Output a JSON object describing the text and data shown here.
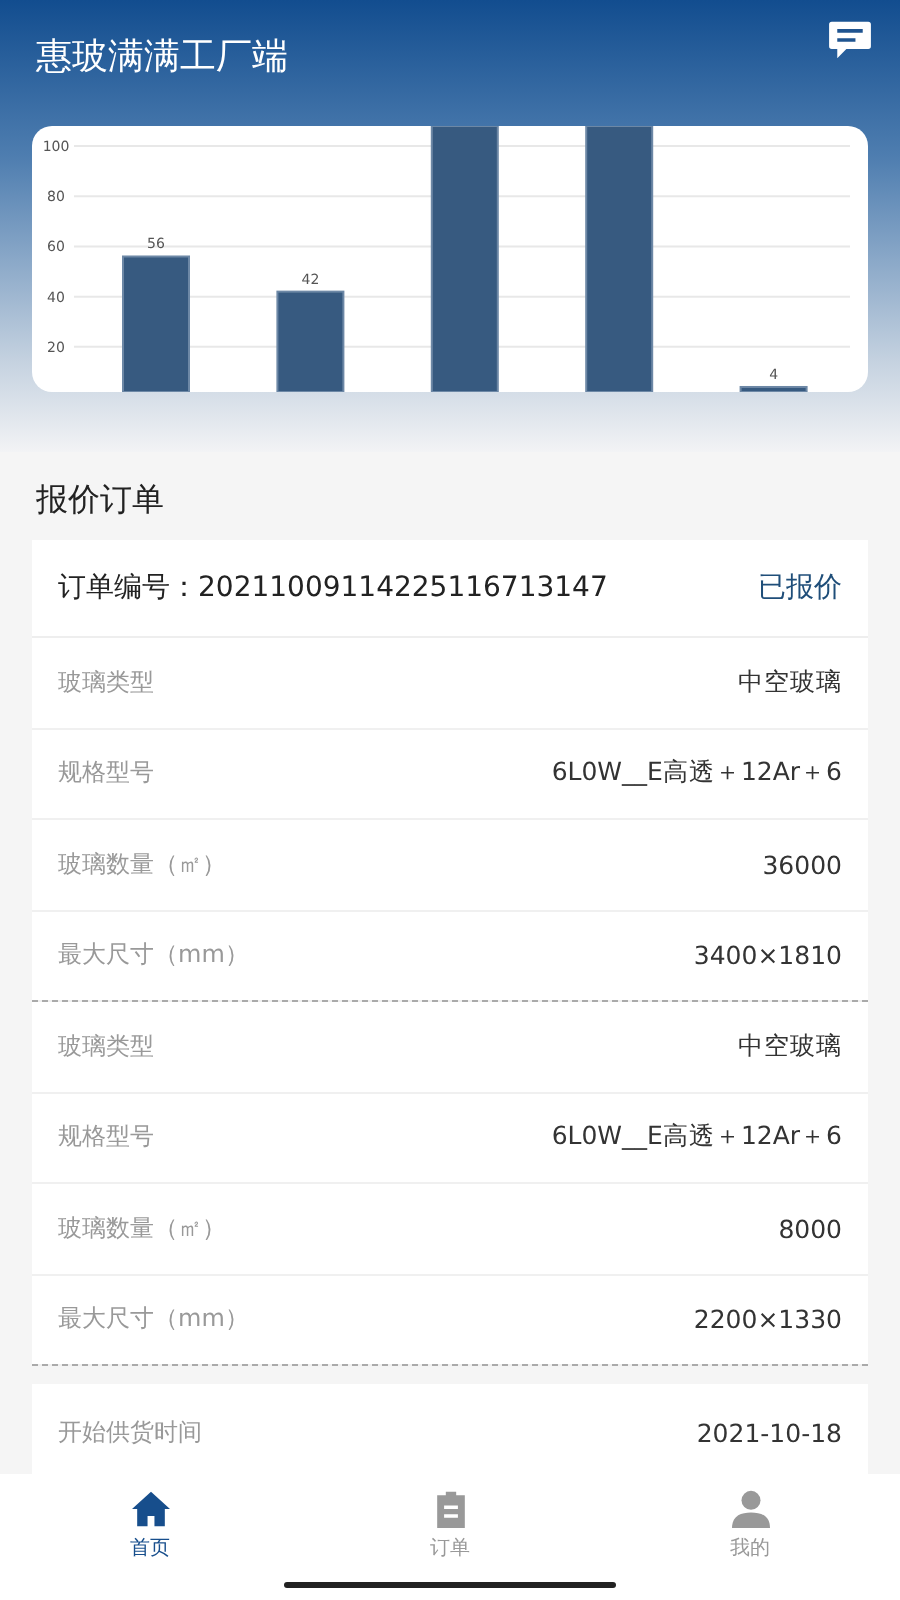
{
  "header": {
    "title": "惠玻满满工厂端"
  },
  "chart": {
    "chart_data": {
      "type": "bar",
      "ylim": [
        2,
        108
      ],
      "yticks": [
        20,
        40,
        60,
        80,
        100
      ],
      "grid": true,
      "value_labels": [
        "56",
        "42",
        null,
        null,
        "4"
      ],
      "series": [
        {
          "color": "#375a80",
          "values": [
            56,
            42,
            108,
            108,
            4
          ]
        }
      ]
    }
  },
  "section_title": "报价订单",
  "order": {
    "number_label": "订单编号：",
    "number": "20211009114225116713147",
    "status": "已报价",
    "groups": [
      [
        {
          "label": "玻璃类型",
          "value": "中空玻璃"
        },
        {
          "label": "规格型号",
          "value": "6L0W__E高透＋12Ar＋6"
        },
        {
          "label": "玻璃数量（㎡）",
          "value": "36000"
        },
        {
          "label": "最大尺寸（mm）",
          "value": "3400×1810"
        }
      ],
      [
        {
          "label": "玻璃类型",
          "value": "中空玻璃"
        },
        {
          "label": "规格型号",
          "value": "6L0W__E高透＋12Ar＋6"
        },
        {
          "label": "玻璃数量（㎡）",
          "value": "8000"
        },
        {
          "label": "最大尺寸（mm）",
          "value": "2200×1330"
        }
      ]
    ]
  },
  "supply": {
    "label": "开始供货时间",
    "value": "2021-10-18"
  },
  "nav": [
    {
      "label": "首页",
      "kind": "home",
      "selected": true
    },
    {
      "label": "订单",
      "kind": "orders",
      "selected": false
    },
    {
      "label": "我的",
      "kind": "profile",
      "selected": false
    }
  ]
}
